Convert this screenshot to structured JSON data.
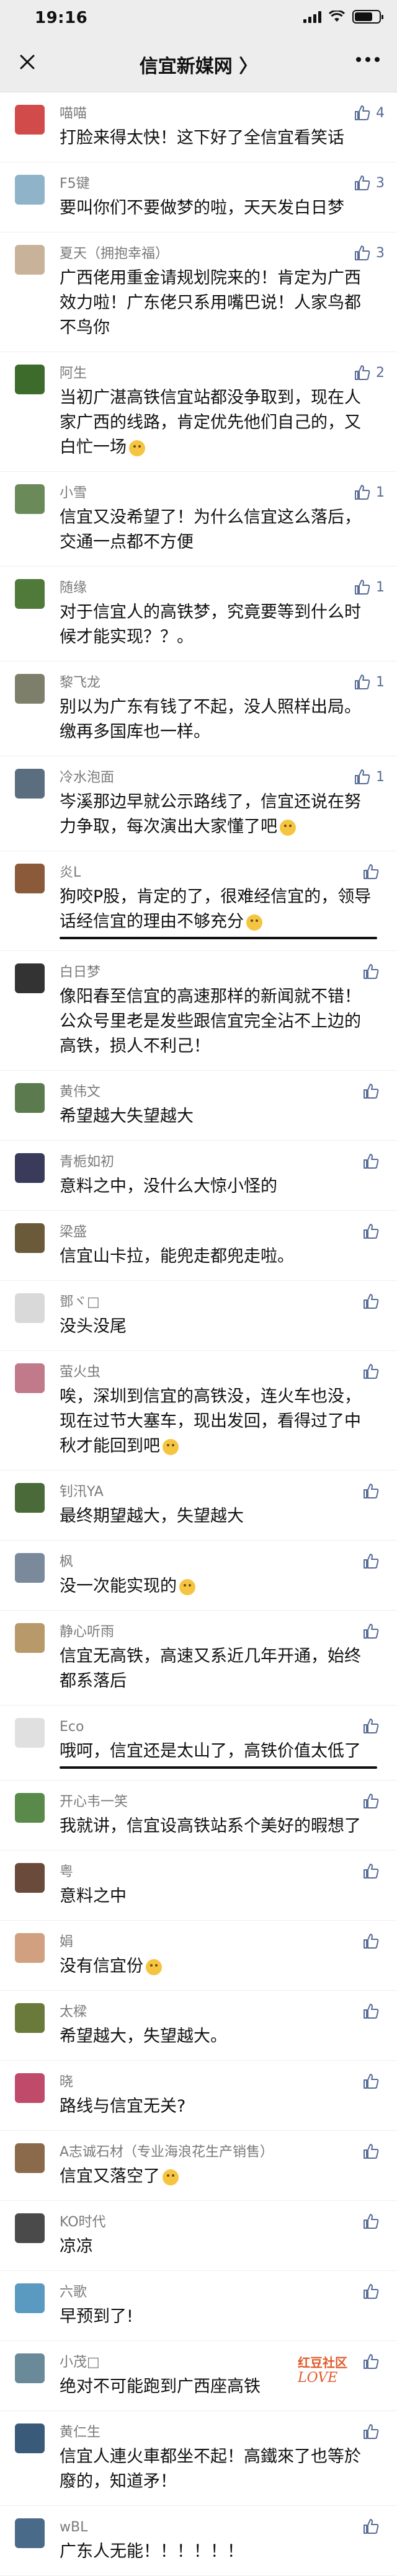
{
  "status": {
    "time": "19:16"
  },
  "nav": {
    "title": "信宜新媒网 〉"
  },
  "comments": [
    {
      "name": "喵喵",
      "text": "打脸来得太快！这下好了全信宜看笑话",
      "likes": "4",
      "color": "#d24b4b"
    },
    {
      "name": "F5键",
      "text": "要叫你们不要做梦的啦，天天发白日梦",
      "likes": "3",
      "color": "#8fb3c9"
    },
    {
      "name": "夏天（拥抱幸福）",
      "text": "广西佬用重金请规划院来的！肯定为广西效力啦！广东佬只系用嘴巴说！人家鸟都不鸟你",
      "likes": "3",
      "color": "#c9b29a"
    },
    {
      "name": "阿生",
      "text": "当初广湛高铁信宜站都没争取到，现在人家广西的线路，肯定优先他们自己的，又白忙一场",
      "likes": "2",
      "color": "#3d6b2b",
      "emoji": true
    },
    {
      "name": "小雪",
      "text": "信宜又没希望了！为什么信宜这么落后，交通一点都不方便",
      "likes": "1",
      "color": "#6b8a5a"
    },
    {
      "name": "随缘",
      "text": "对于信宜人的高铁梦，究竟要等到什么时候才能实现？？。",
      "likes": "1",
      "color": "#4f7a3a"
    },
    {
      "name": "黎飞龙",
      "text": "别以为广东有钱了不起，没人照样出局。缴再多国库也一样。",
      "likes": "1",
      "color": "#7d7f6a"
    },
    {
      "name": "冷水泡面",
      "text": "岑溪那边早就公示路线了，信宜还说在努力争取，每次演出大家懂了吧",
      "likes": "1",
      "color": "#5a6e7f",
      "emoji": true
    },
    {
      "name": "炎L",
      "text": "狗咬P股，肯定的了，很难经信宜的，领导话经信宜的理由不够充分",
      "likes": "",
      "color": "#8a5a3a",
      "emoji": true,
      "underline": true
    },
    {
      "name": "白日梦",
      "text": "像阳春至信宜的高速那样的新闻就不错！公众号里老是发些跟信宜完全沾不上边的高铁，损人不利己！",
      "likes": "",
      "color": "#333333"
    },
    {
      "name": "黄伟文",
      "text": "希望越大失望越大",
      "likes": "",
      "color": "#5b7a4e"
    },
    {
      "name": "青栀如初",
      "text": "意料之中，没什么大惊小怪的",
      "likes": "",
      "color": "#3a3a5a"
    },
    {
      "name": "梁盛",
      "text": "信宜山卡拉，能兜走都兜走啦。",
      "likes": "",
      "color": "#6a5a3a"
    },
    {
      "name": "鄧ヾ□",
      "text": "没头没尾",
      "likes": "",
      "color": "#d9d9d9"
    },
    {
      "name": "萤火虫",
      "text": "唉，深圳到信宜的高铁没，连火车也没，现在过节大塞车，现出发回，看得过了中秋才能回到吧",
      "likes": "",
      "color": "#c07a8a",
      "emoji": true
    },
    {
      "name": "钊汛YA",
      "text": "最终期望越大，失望越大",
      "likes": "",
      "color": "#4a6a3a"
    },
    {
      "name": "枫",
      "text": "没一次能实现的",
      "likes": "",
      "color": "#7a8a9a",
      "emoji": true
    },
    {
      "name": "静心听雨",
      "text": "信宜无高铁，高速又系近几年开通，始终都系落后",
      "likes": "",
      "color": "#b89a6a"
    },
    {
      "name": "Eco",
      "text": "哦呵，信宜还是太山了，高铁价值太低了",
      "likes": "",
      "color": "#e0e0e0",
      "underline": true
    },
    {
      "name": "开心韦一笑",
      "text": "我就讲，信宜设高铁站系个美好的暇想了",
      "likes": "",
      "color": "#5a8a4a"
    },
    {
      "name": "粤",
      "text": "意料之中",
      "likes": "",
      "color": "#6a4a3a"
    },
    {
      "name": "娟",
      "text": "没有信宜份",
      "likes": "",
      "color": "#d0a080",
      "emoji": true
    },
    {
      "name": "太樑",
      "text": "希望越大，失望越大。",
      "likes": "",
      "color": "#6a7a3a"
    },
    {
      "name": "晓",
      "text": "路线与信宜无关?",
      "likes": "",
      "color": "#c04a6a"
    },
    {
      "name": "A志诚石材（专业海浪花生产销售）",
      "text": "信宜又落空了",
      "likes": "",
      "color": "#8a6a4a",
      "emoji": true
    },
    {
      "name": "KO时代",
      "text": "凉凉",
      "likes": "",
      "color": "#4a4a4a"
    },
    {
      "name": "六歌",
      "text": "早预到了!",
      "likes": "",
      "color": "#5a9ac0"
    },
    {
      "name": "小茂□",
      "text": "绝对不可能跑到广西座高铁",
      "likes": "",
      "color": "#6a8a9a"
    },
    {
      "name": "黄仁生",
      "text": "信宜人連火車都坐不起！高鐵來了也等於廢的，知道矛！",
      "likes": "",
      "color": "#3a5a7a"
    },
    {
      "name": "wBL",
      "text": "广东人无能！！！！！！",
      "likes": "",
      "color": "#4a6a8a"
    }
  ],
  "watermark": "红豆社区"
}
